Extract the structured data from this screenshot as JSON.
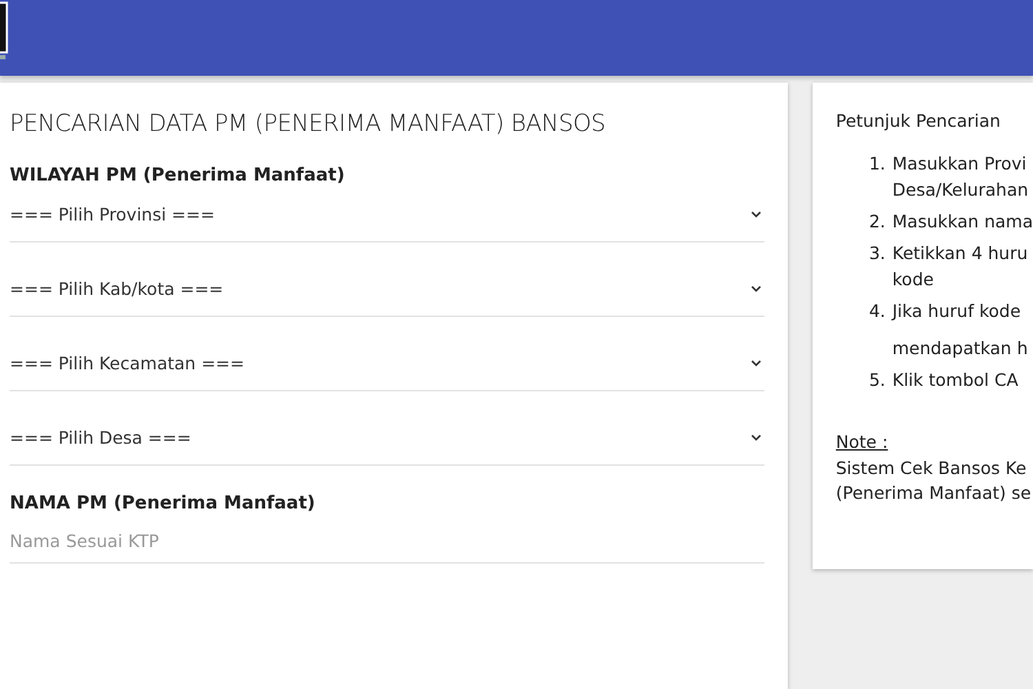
{
  "form": {
    "title": "PENCARIAN DATA PM (PENERIMA MANFAAT) BANSOS",
    "region_label": "WILAYAH PM (Penerima Manfaat)",
    "selects": [
      {
        "value": "=== Pilih Provinsi ==="
      },
      {
        "value": "=== Pilih Kab/kota ==="
      },
      {
        "value": "=== Pilih Kecamatan ==="
      },
      {
        "value": "=== Pilih Desa ==="
      }
    ],
    "name_label": "NAMA PM (Penerima Manfaat)",
    "name_field": {
      "placeholder": "Nama Sesuai KTP"
    }
  },
  "guide": {
    "title": "Petunjuk Pencarian",
    "steps": [
      {
        "number": "1.",
        "lines": [
          "Masukkan Provi",
          "Desa/Kelurahan"
        ]
      },
      {
        "number": "2.",
        "lines": [
          "Masukkan nama"
        ]
      },
      {
        "number": "3.",
        "lines": [
          "Ketikkan 4 huru",
          "kode"
        ]
      },
      {
        "number": "4.",
        "lines": [
          "Jika huruf kode",
          "mendapatkan h"
        ]
      },
      {
        "number": "5.",
        "lines": [
          "Klik tombol CA"
        ]
      }
    ],
    "note_label": "Note :",
    "note_lines": [
      "Sistem Cek Bansos Ke",
      "(Penerima Manfaat) se"
    ]
  }
}
